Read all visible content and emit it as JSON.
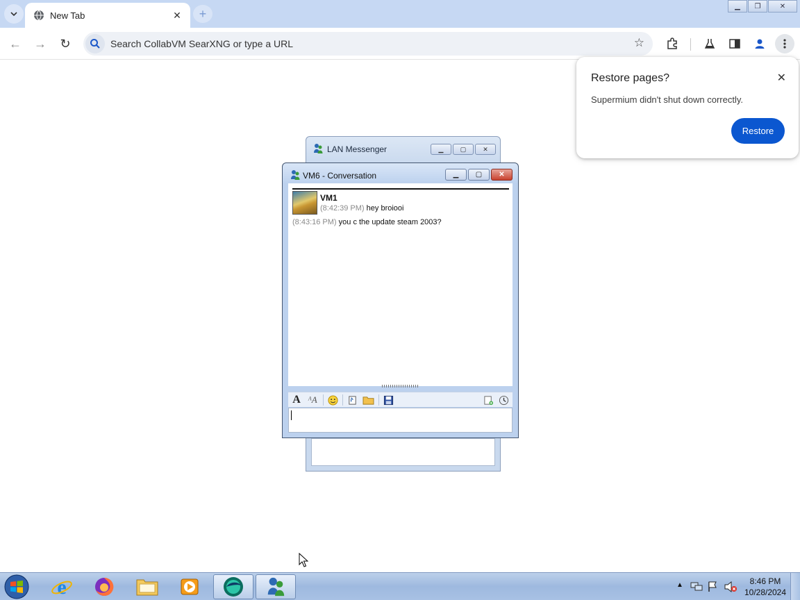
{
  "browser": {
    "tab_title": "New Tab",
    "omnibox_placeholder": "Search CollabVM SearXNG or type a URL"
  },
  "restore_bubble": {
    "title": "Restore pages?",
    "message": "Supermium didn't shut down correctly.",
    "button": "Restore"
  },
  "lan_messenger": {
    "title": "LAN Messenger"
  },
  "conversation": {
    "title": "VM6 - Conversation",
    "sender": "VM1",
    "messages": [
      {
        "time": "(8:42:39 PM)",
        "text": "hey broiooi"
      },
      {
        "time": "(8:43:16 PM)",
        "text": "you c the update steam 2003?"
      }
    ],
    "input_value": ""
  },
  "taskbar": {
    "time": "8:46 PM",
    "date": "10/28/2024",
    "apps": [
      "internet-explorer",
      "firefox",
      "file-explorer",
      "media-player",
      "supermium",
      "lan-messenger"
    ]
  },
  "colors": {
    "accent": "#0b57d0",
    "tabstrip": "#c6d8f3"
  }
}
